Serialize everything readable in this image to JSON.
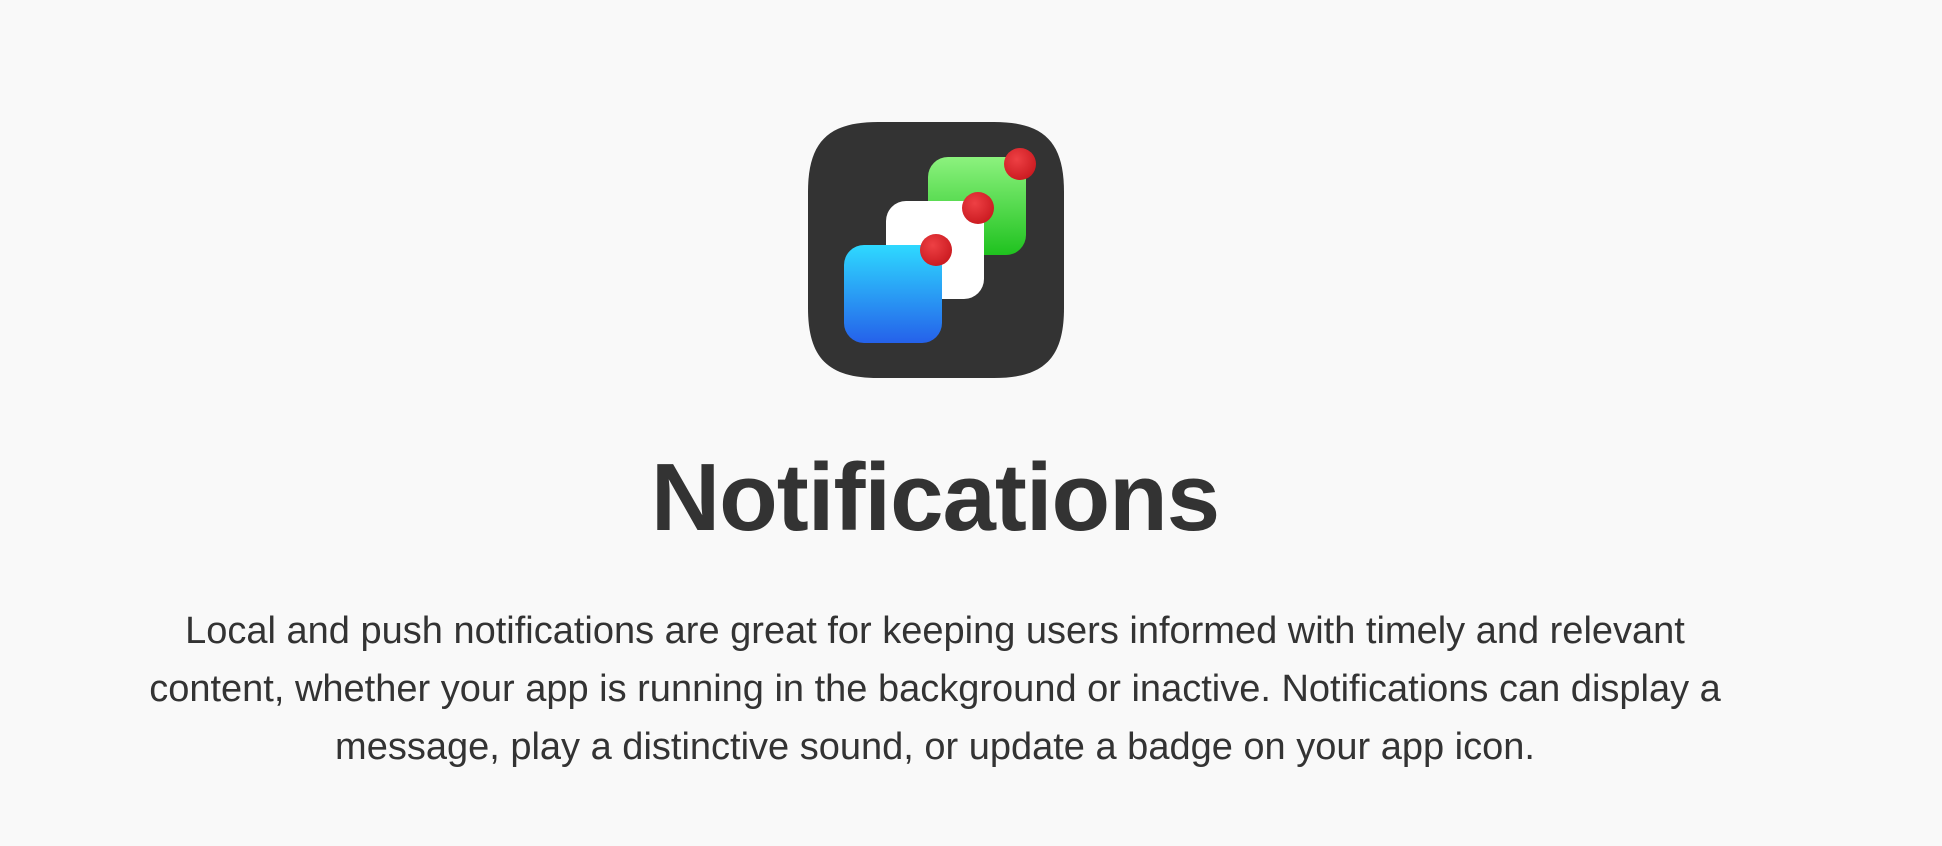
{
  "page": {
    "title": "Notifications",
    "description": "Local and push notifications are great for keeping users informed with timely and relevant content, whether your app is running in the background or inactive. Notifications can display a message, play a distinctive sound, or update a badge on your app icon."
  },
  "icon": {
    "name": "notifications-app-icon",
    "colors": {
      "background": "#333333",
      "green_top": "#8cf27e",
      "green_bottom": "#1fc21f",
      "white": "#ffffff",
      "blue_top": "#2ed9ff",
      "blue_bottom": "#2561ea",
      "badge_red": "#dd2a2e"
    }
  }
}
